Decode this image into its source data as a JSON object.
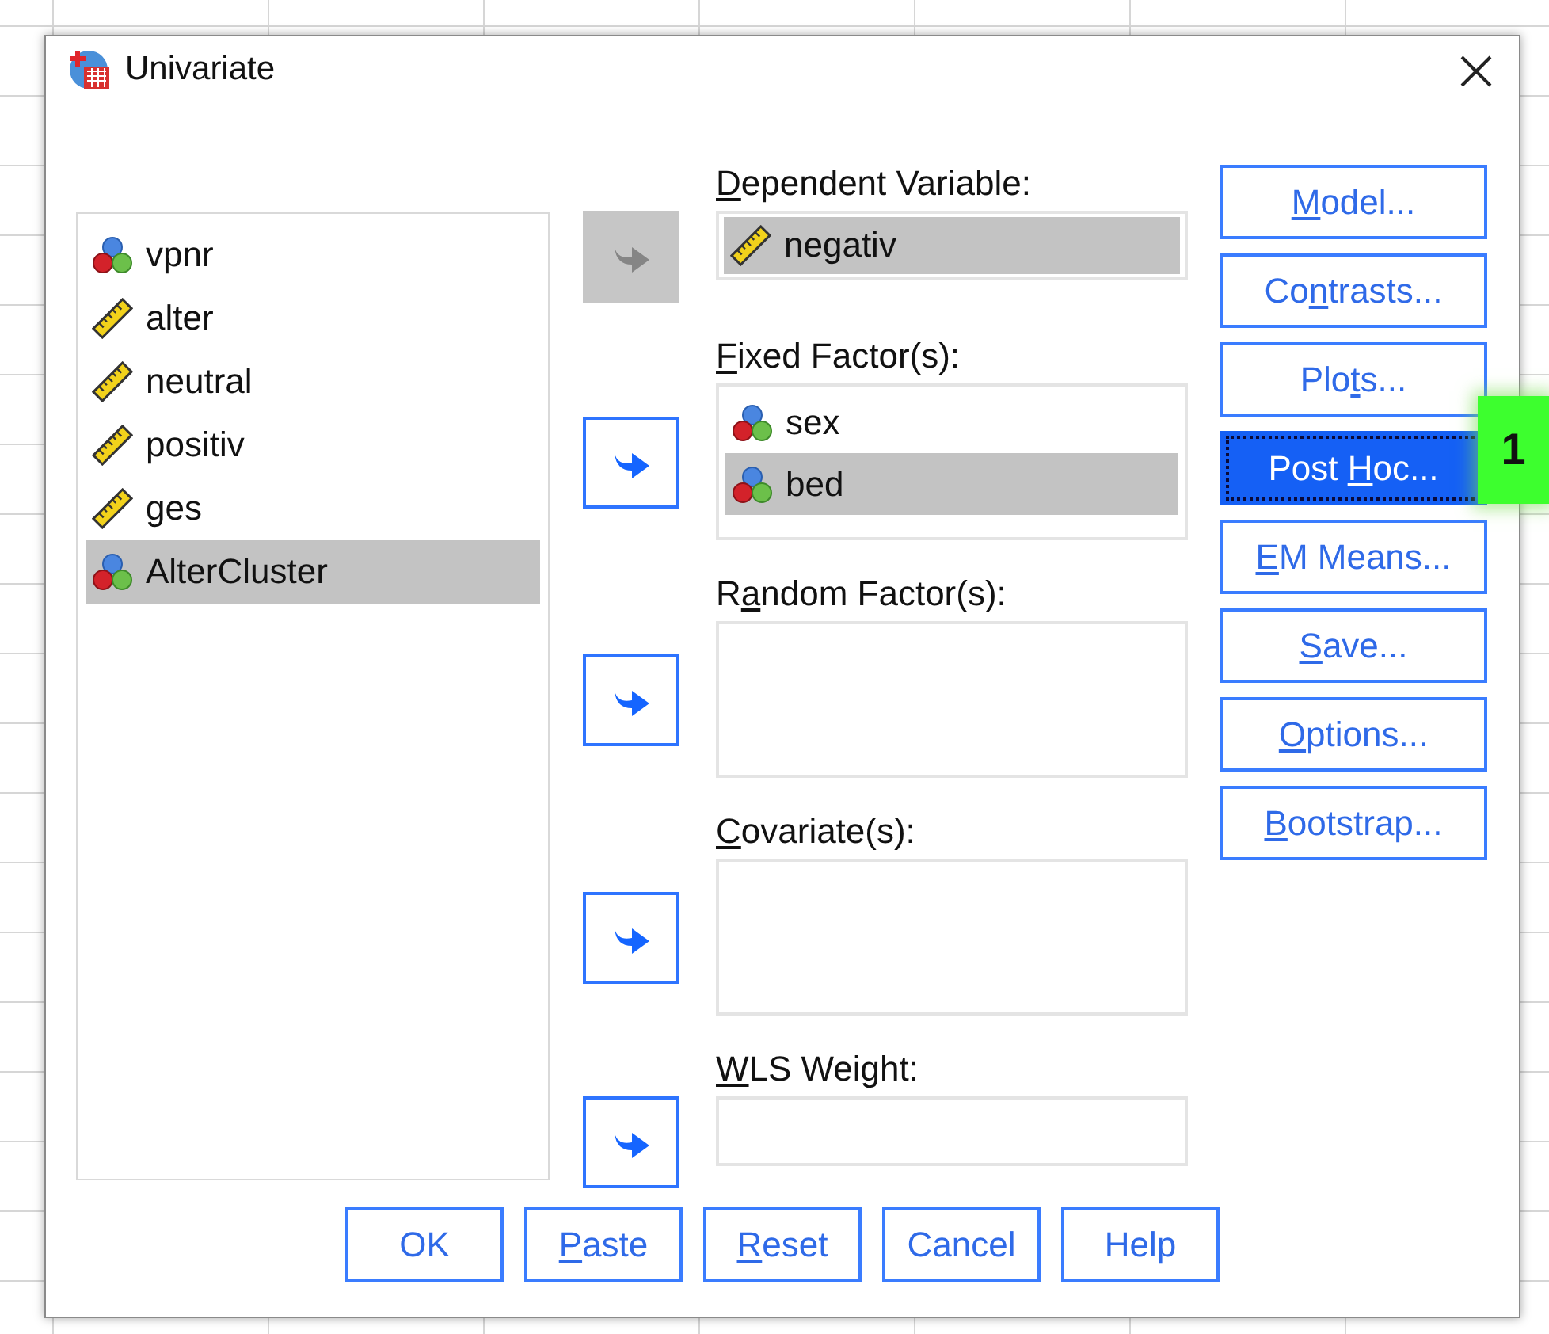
{
  "window": {
    "title": "Univariate"
  },
  "source_list": {
    "items": [
      {
        "name": "vpnr",
        "kind": "nominal",
        "selected": false
      },
      {
        "name": "alter",
        "kind": "scale",
        "selected": false
      },
      {
        "name": "neutral",
        "kind": "scale",
        "selected": false
      },
      {
        "name": "positiv",
        "kind": "scale",
        "selected": false
      },
      {
        "name": "ges",
        "kind": "scale",
        "selected": false
      },
      {
        "name": "AlterCluster",
        "kind": "nominal",
        "selected": true
      }
    ]
  },
  "targets": [
    {
      "label": {
        "key": "D",
        "post": "ependent Variable:"
      },
      "kind": "single",
      "arrow_disabled": true,
      "items": [
        {
          "name": "negativ",
          "kind": "scale",
          "selected": true
        }
      ]
    },
    {
      "label": {
        "key": "F",
        "post": "ixed Factor(s):"
      },
      "kind": "list",
      "arrow_disabled": false,
      "items": [
        {
          "name": "sex",
          "kind": "nominal",
          "selected": false
        },
        {
          "name": "bed",
          "kind": "nominal",
          "selected": true
        }
      ]
    },
    {
      "label": {
        "pre": "R",
        "key": "a",
        "post": "ndom Factor(s):"
      },
      "kind": "list",
      "arrow_disabled": false
    },
    {
      "label": {
        "key": "C",
        "post": "ovariate(s):"
      },
      "kind": "list",
      "arrow_disabled": false
    },
    {
      "label": {
        "key": "W",
        "post": "LS Weight:"
      },
      "kind": "single",
      "arrow_disabled": false
    }
  ],
  "side_buttons": [
    {
      "label": {
        "key": "M",
        "post": "odel..."
      },
      "focused": false
    },
    {
      "label": {
        "pre": "Co",
        "key": "n",
        "post": "trasts..."
      },
      "focused": false
    },
    {
      "label": {
        "pre": "Plo",
        "key": "t",
        "post": "s..."
      },
      "focused": false
    },
    {
      "label": {
        "pre": "Post ",
        "key": "H",
        "post": "oc..."
      },
      "focused": true
    },
    {
      "label": {
        "key": "E",
        "post": "M Means..."
      },
      "focused": false
    },
    {
      "label": {
        "key": "S",
        "post": "ave..."
      },
      "focused": false
    },
    {
      "label": {
        "key": "O",
        "post": "ptions..."
      },
      "focused": false
    },
    {
      "label": {
        "key": "B",
        "post": "ootstrap..."
      },
      "focused": false
    }
  ],
  "bottom_buttons": [
    {
      "label": {
        "pre": "OK"
      }
    },
    {
      "label": {
        "key": "P",
        "post": "aste"
      }
    },
    {
      "label": {
        "key": "R",
        "post": "eset"
      }
    },
    {
      "label": {
        "pre": "Cancel"
      }
    },
    {
      "label": {
        "pre": "Help"
      }
    }
  ],
  "annotation_badge": {
    "text": "1"
  }
}
